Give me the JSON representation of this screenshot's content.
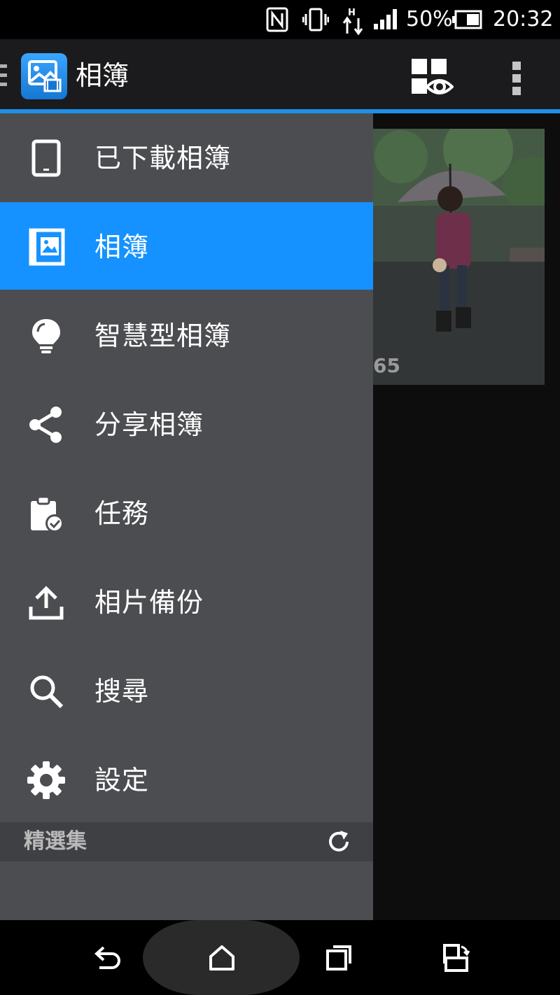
{
  "status_bar": {
    "battery": "50%",
    "time": "20:32",
    "network": "H"
  },
  "action_bar": {
    "title": "相簿"
  },
  "background": {
    "album_count_partial": "65"
  },
  "drawer": {
    "items": [
      {
        "label": "已下載相簿",
        "icon": "tablet-icon"
      },
      {
        "label": "相簿",
        "icon": "photo-album-icon",
        "selected": true
      },
      {
        "label": "智慧型相簿",
        "icon": "lightbulb-icon"
      },
      {
        "label": "分享相簿",
        "icon": "share-icon"
      },
      {
        "label": "任務",
        "icon": "clipboard-check-icon"
      },
      {
        "label": "相片備份",
        "icon": "upload-icon"
      },
      {
        "label": "搜尋",
        "icon": "search-icon"
      },
      {
        "label": "設定",
        "icon": "gear-icon"
      }
    ],
    "section_title": "精選集"
  },
  "colors": {
    "accent": "#1592ff",
    "drawer_bg": "#4c4d51",
    "action_bar_bg": "#1b1b1d"
  }
}
